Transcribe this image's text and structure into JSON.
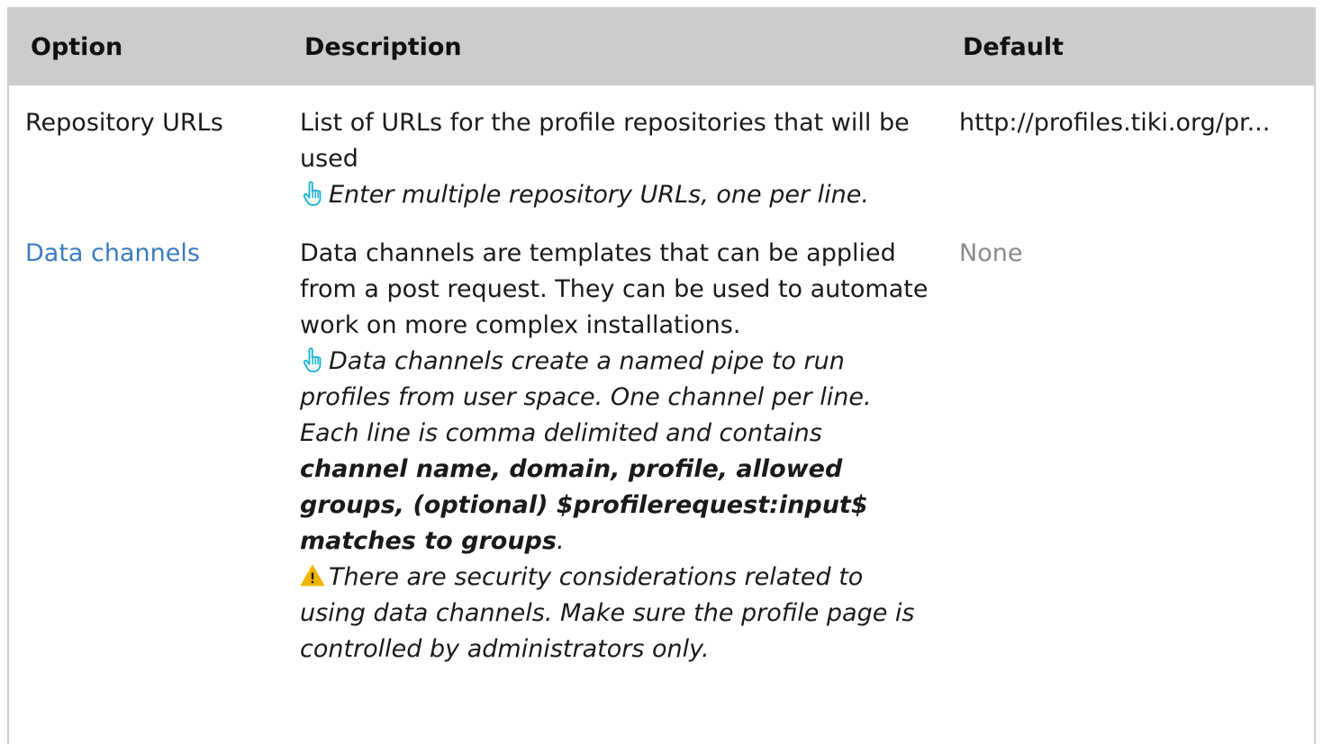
{
  "table": {
    "headers": {
      "option": "Option",
      "description": "Description",
      "default": "Default"
    },
    "rows": [
      {
        "option": "Repository URLs",
        "description": "List of URLs for the profile repositories that will be used",
        "hint": "Enter multiple repository URLs, one per line.",
        "default": "http://profiles.tiki.org/pr..."
      },
      {
        "option": "Data channels",
        "description": "Data channels are templates that can be applied from a post request. They can be used to automate work on more complex installations.",
        "hint_prefix": "Data channels create a named pipe to run profiles from user space. One channel per line. Each line is comma delimited and contains",
        "hint_bold": "channel name, domain, profile, allowed groups, (optional) $profilerequest:input$ matches to groups",
        "hint_suffix": ".",
        "warning": "There are security considerations related to using data channels. Make sure the profile page is controlled by administrators only.",
        "default": "None"
      }
    ]
  },
  "icons": {
    "hint": "pointing-hand-icon",
    "warning": "warning-triangle-icon"
  },
  "colors": {
    "header_bg": "#cccccc",
    "link": "#3a7cc0",
    "hint_icon": "#1ab3d6",
    "warning_icon": "#f0b400",
    "muted": "#8a8a8a"
  }
}
